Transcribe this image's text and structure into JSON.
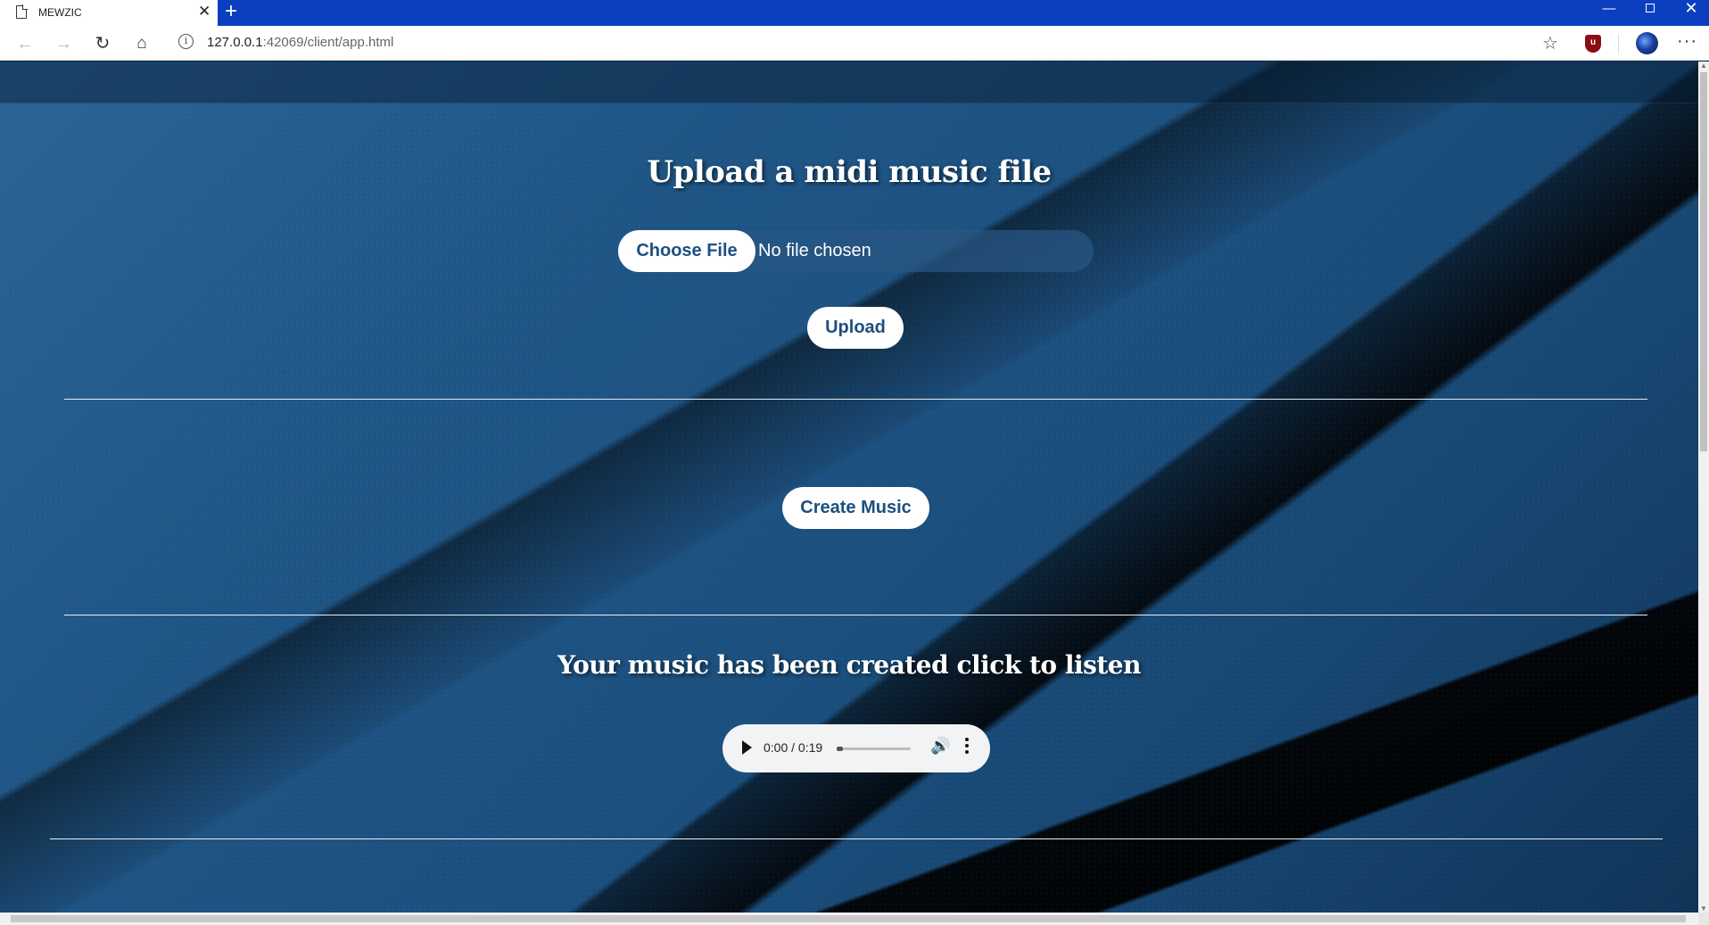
{
  "browser": {
    "tab_title": "MEWZIC",
    "tab_close": "✕",
    "new_tab": "+",
    "url_host": "127.0.0.1",
    "url_path": ":42069/client/app.html",
    "window_min": "—",
    "window_close": "✕",
    "ext_label": "u"
  },
  "upload": {
    "heading": "Upload a midi music file",
    "choose_label": "Choose File",
    "no_file": "No file chosen",
    "upload_label": "Upload"
  },
  "create": {
    "button_label": "Create Music"
  },
  "result": {
    "heading": "Your music has been created click to listen",
    "player_time": "0:00 / 0:19",
    "progress": 0
  },
  "icons": {
    "back": "back-arrow-icon",
    "forward": "forward-arrow-icon",
    "reload": "reload-icon",
    "home": "home-icon",
    "info": "info-icon",
    "favorite": "star-icon",
    "extension": "ublock-shield-icon",
    "profile": "profile-avatar-icon",
    "more": "more-menu-icon",
    "play": "play-icon",
    "volume": "volume-icon",
    "player_menu": "kebab-menu-icon"
  },
  "colors": {
    "tabbar": "#0b3fbf",
    "button_text": "#1d4f80",
    "page_bg": "#1f5585"
  }
}
